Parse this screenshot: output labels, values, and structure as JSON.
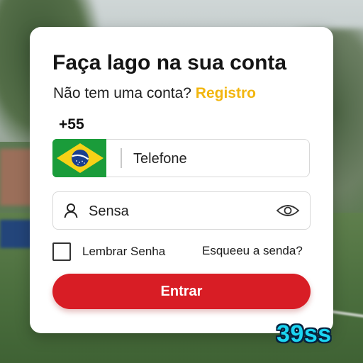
{
  "login": {
    "title": "Faça lago na sua conta",
    "subtitle_prefix": "Não tem uma conta? ",
    "register_link": "Registro",
    "country_code": "+55",
    "country_flag": "brazil-flag-icon",
    "phone_placeholder": "Telefone",
    "password_placeholder": "Sensa",
    "remember_label": "Lembrar Senha",
    "remember_checked": false,
    "forgot_link": "Esqueeu a senda?",
    "submit_label": "Entrar"
  },
  "watermark": "39ss",
  "colors": {
    "accent_yellow": "#f2b60f",
    "button_red": "#d81d25",
    "watermark_cyan": "#1bd5f2",
    "flag_green": "#1a9c3a",
    "flag_yellow": "#f7d117",
    "flag_blue": "#1a3f8f"
  }
}
